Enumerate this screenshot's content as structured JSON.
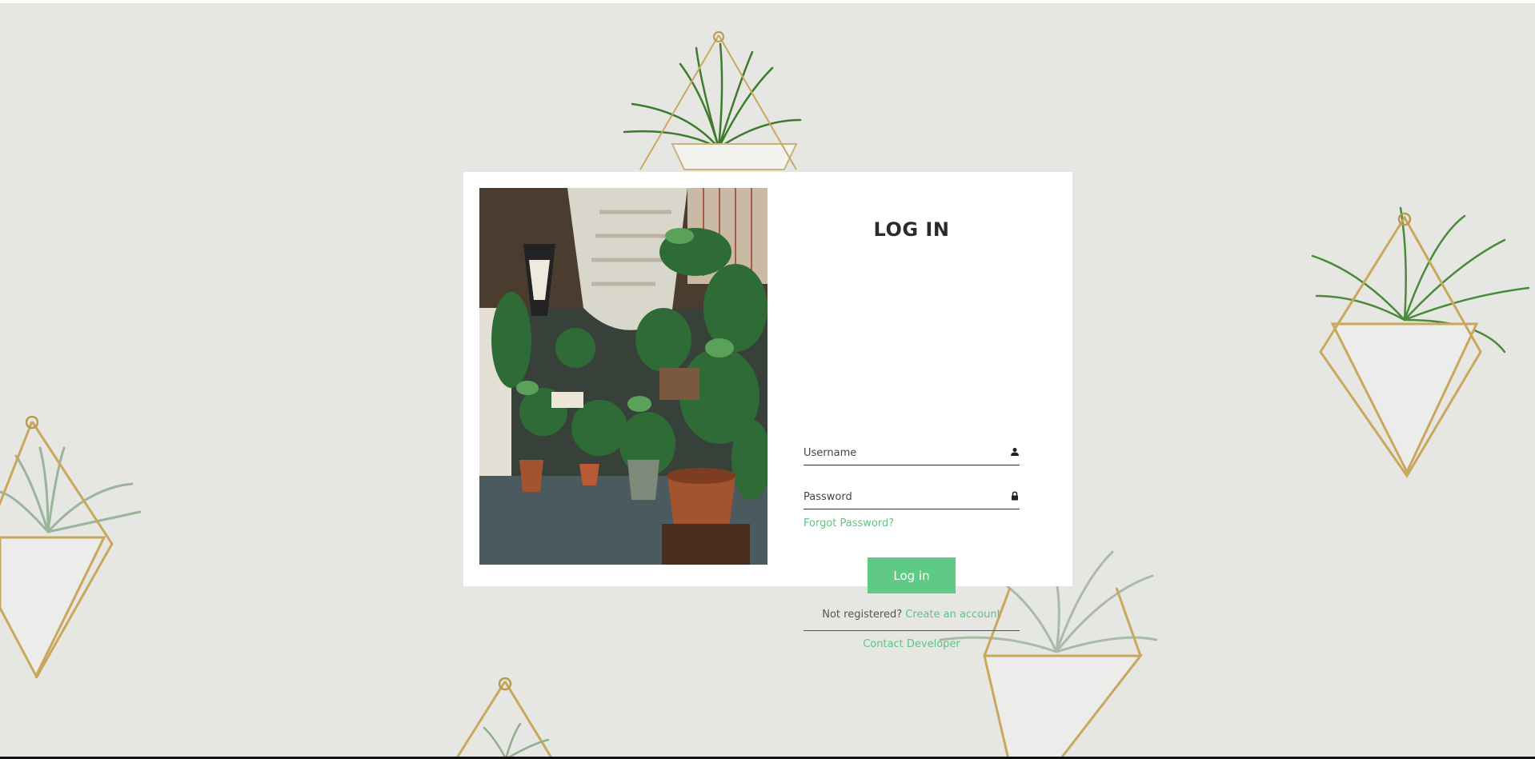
{
  "colors": {
    "accent": "#5fc986",
    "background": "#e6e6e3",
    "card": "#ffffff",
    "text_dark": "#2b2b2b"
  },
  "login": {
    "title": "LOG IN",
    "username_placeholder": "Username",
    "username_icon": "user-icon",
    "password_placeholder": "Password",
    "password_icon": "lock-icon",
    "forgot_label": "Forgot Password?",
    "submit_label": "Log in",
    "not_registered_text": "Not registered?",
    "create_account_label": "Create an account",
    "contact_label": "Contact Developer"
  }
}
